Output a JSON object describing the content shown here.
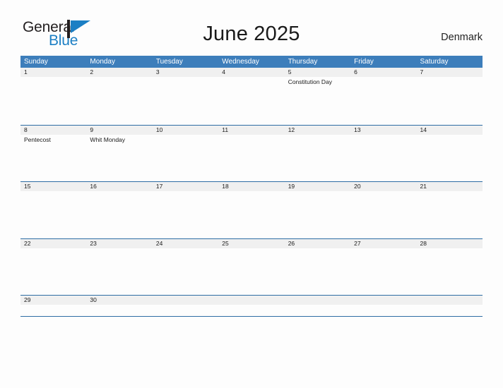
{
  "brand": {
    "name_part1": "General",
    "name_part2": "Blue",
    "mark_icon": "blue-flag-triangle-icon",
    "color_dark": "#231f20",
    "color_blue": "#1c7fc4"
  },
  "header": {
    "title": "June 2025",
    "region": "Denmark"
  },
  "theme": {
    "header_blue": "#3d7ebb",
    "rule_blue": "#2e6da4",
    "band_gray": "#f0f0f0",
    "page_background": "#fdfdfd",
    "text": "#1a1a1a"
  },
  "calendar": {
    "month": "June",
    "year": "2025",
    "weekdays": [
      "Sunday",
      "Monday",
      "Tuesday",
      "Wednesday",
      "Thursday",
      "Friday",
      "Saturday"
    ],
    "weeks": [
      {
        "days": [
          {
            "num": "1",
            "events": []
          },
          {
            "num": "2",
            "events": []
          },
          {
            "num": "3",
            "events": []
          },
          {
            "num": "4",
            "events": []
          },
          {
            "num": "5",
            "events": [
              "Constitution Day"
            ]
          },
          {
            "num": "6",
            "events": []
          },
          {
            "num": "7",
            "events": []
          }
        ]
      },
      {
        "days": [
          {
            "num": "8",
            "events": [
              "Pentecost"
            ]
          },
          {
            "num": "9",
            "events": [
              "Whit Monday"
            ]
          },
          {
            "num": "10",
            "events": []
          },
          {
            "num": "11",
            "events": []
          },
          {
            "num": "12",
            "events": []
          },
          {
            "num": "13",
            "events": []
          },
          {
            "num": "14",
            "events": []
          }
        ]
      },
      {
        "days": [
          {
            "num": "15",
            "events": []
          },
          {
            "num": "16",
            "events": []
          },
          {
            "num": "17",
            "events": []
          },
          {
            "num": "18",
            "events": []
          },
          {
            "num": "19",
            "events": []
          },
          {
            "num": "20",
            "events": []
          },
          {
            "num": "21",
            "events": []
          }
        ]
      },
      {
        "days": [
          {
            "num": "22",
            "events": []
          },
          {
            "num": "23",
            "events": []
          },
          {
            "num": "24",
            "events": []
          },
          {
            "num": "25",
            "events": []
          },
          {
            "num": "26",
            "events": []
          },
          {
            "num": "27",
            "events": []
          },
          {
            "num": "28",
            "events": []
          }
        ]
      },
      {
        "days": [
          {
            "num": "29",
            "events": []
          },
          {
            "num": "30",
            "events": []
          },
          {
            "num": "",
            "events": []
          },
          {
            "num": "",
            "events": []
          },
          {
            "num": "",
            "events": []
          },
          {
            "num": "",
            "events": []
          },
          {
            "num": "",
            "events": []
          }
        ]
      }
    ]
  }
}
